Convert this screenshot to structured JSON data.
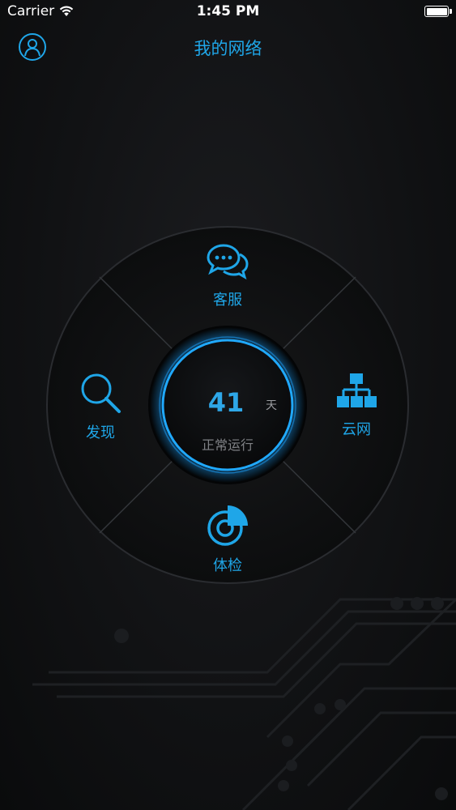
{
  "status_bar": {
    "carrier": "Carrier",
    "time": "1:45 PM",
    "icons": [
      "wifi-icon",
      "battery-icon"
    ]
  },
  "nav": {
    "title": "我的网络",
    "profile_icon": "user-icon"
  },
  "menu": {
    "top": {
      "label": "客服",
      "icon": "chat-bubbles-icon"
    },
    "left": {
      "label": "发现",
      "icon": "search-icon"
    },
    "right": {
      "label": "云网",
      "icon": "network-topology-icon"
    },
    "bottom": {
      "label": "体检",
      "icon": "checkup-gauge-icon"
    }
  },
  "center": {
    "value": "41",
    "unit": "天",
    "status": "正常运行"
  },
  "colors": {
    "accent": "#1fa6e8",
    "background": "#111214",
    "ring_glow": "#1ea3ff"
  }
}
